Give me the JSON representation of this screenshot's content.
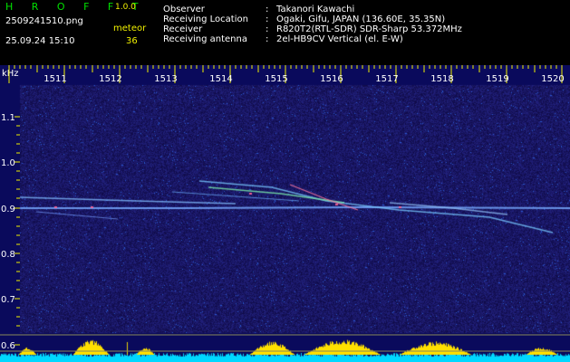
{
  "app": {
    "brand": "H R O F F T",
    "version": "1.0.0",
    "filename": "2509241510.png",
    "datetime": "25.09.24 15:10",
    "event_label": "meteor",
    "event_count": "36"
  },
  "info": [
    {
      "key": "Observer",
      "sep": ":",
      "value": "Takanori Kawachi"
    },
    {
      "key": "Receiving Location",
      "sep": ":",
      "value": "Ogaki, Gifu, JAPAN (136.60E, 35.35N)"
    },
    {
      "key": "Receiver",
      "sep": ":",
      "value": "R820T2(RTL-SDR) SDR-Sharp 53.372MHz"
    },
    {
      "key": "Receiving antenna",
      "sep": ":",
      "value": "2el-HB9CV Vertical (el. E-W)"
    }
  ],
  "axes": {
    "y_unit": "kHz",
    "x_ticks": [
      "1511",
      "1512",
      "1513",
      "1514",
      "1515",
      "1516",
      "1517",
      "1518",
      "1519",
      "1520"
    ],
    "y_ticks": [
      "1.1",
      "1.0",
      "0.9",
      "0.8",
      "0.7",
      "0.6"
    ]
  },
  "colors": {
    "background": "#000000",
    "plot_bg": "#0a0a5c",
    "brand": "#00e000",
    "label_yellow": "#f0f000",
    "tick_yellow": "#f0f000",
    "power_fill": "#00d8ff",
    "power_peak": "#ffe000"
  }
}
